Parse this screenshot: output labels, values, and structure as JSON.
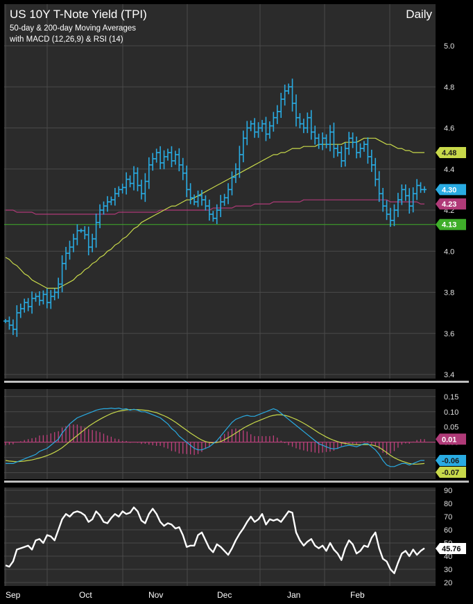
{
  "colors": {
    "background": "#2b2b2b",
    "grid": "#4a4a4a",
    "price": "#29abe2",
    "ma50": "#c8d94a",
    "ma200": "#b03a78",
    "support": "#3fae2a",
    "rsi": "#ffffff",
    "macd": "#29abe2",
    "signal": "#c8d94a",
    "histogram": "#c2407e"
  },
  "chart_data": [
    {
      "type": "line",
      "panel": "price",
      "title": "US 10Y T-Note Yield (TPI)",
      "subtitle_lines": [
        "50-day & 200-day Moving Averages",
        "with MACD (12,26,9) & RSI (14)"
      ],
      "period_label": "Daily",
      "ylim": [
        3.4,
        5.0
      ],
      "y_ticks": [
        "3.4",
        "3.6",
        "3.8",
        "4.0",
        "4.2",
        "4.4",
        "4.6",
        "4.8",
        "5.0"
      ],
      "x_months": [
        "Sep",
        "Oct",
        "Nov",
        "Dec",
        "Jan",
        "Feb"
      ],
      "series": [
        {
          "key": "price",
          "values": [
            3.66,
            3.64,
            3.62,
            3.7,
            3.72,
            3.75,
            3.73,
            3.77,
            3.78,
            3.76,
            3.79,
            3.75,
            3.78,
            3.8,
            3.84,
            3.94,
            3.99,
            4.02,
            4.06,
            4.1,
            4.1,
            4.08,
            4.02,
            4.06,
            4.14,
            4.2,
            4.22,
            4.24,
            4.25,
            4.28,
            4.3,
            4.31,
            4.35,
            4.33,
            4.38,
            4.32,
            4.28,
            4.34,
            4.42,
            4.45,
            4.48,
            4.43,
            4.46,
            4.48,
            4.44,
            4.47,
            4.42,
            4.38,
            4.3,
            4.26,
            4.24,
            4.27,
            4.25,
            4.22,
            4.18,
            4.16,
            4.2,
            4.24,
            4.26,
            4.3,
            4.36,
            4.4,
            4.47,
            4.55,
            4.6,
            4.62,
            4.58,
            4.6,
            4.62,
            4.57,
            4.61,
            4.65,
            4.68,
            4.74,
            4.78,
            4.8,
            4.72,
            4.65,
            4.62,
            4.6,
            4.65,
            4.58,
            4.55,
            4.52,
            4.55,
            4.52,
            4.58,
            4.5,
            4.48,
            4.44,
            4.5,
            4.55,
            4.53,
            4.48,
            4.5,
            4.52,
            4.46,
            4.42,
            4.35,
            4.28,
            4.22,
            4.18,
            4.15,
            4.2,
            4.25,
            4.3,
            4.27,
            4.22,
            4.28,
            4.32,
            4.3,
            4.3
          ]
        },
        {
          "key": "ma50",
          "values": [
            3.97,
            3.96,
            3.94,
            3.93,
            3.91,
            3.89,
            3.88,
            3.86,
            3.85,
            3.84,
            3.83,
            3.82,
            3.82,
            3.82,
            3.82,
            3.83,
            3.84,
            3.85,
            3.86,
            3.88,
            3.89,
            3.91,
            3.92,
            3.94,
            3.95,
            3.97,
            3.98,
            4.0,
            4.01,
            4.03,
            4.04,
            4.06,
            4.07,
            4.09,
            4.11,
            4.12,
            4.14,
            4.15,
            4.16,
            4.17,
            4.18,
            4.19,
            4.2,
            4.21,
            4.22,
            4.22,
            4.23,
            4.24,
            4.25,
            4.25,
            4.26,
            4.27,
            4.28,
            4.29,
            4.3,
            4.31,
            4.32,
            4.33,
            4.34,
            4.35,
            4.36,
            4.37,
            4.38,
            4.39,
            4.4,
            4.41,
            4.42,
            4.43,
            4.44,
            4.45,
            4.46,
            4.47,
            4.47,
            4.48,
            4.48,
            4.49,
            4.5,
            4.5,
            4.5,
            4.51,
            4.51,
            4.51,
            4.51,
            4.52,
            4.52,
            4.52,
            4.52,
            4.52,
            4.52,
            4.52,
            4.53,
            4.53,
            4.53,
            4.53,
            4.54,
            4.55,
            4.55,
            4.55,
            4.55,
            4.54,
            4.53,
            4.52,
            4.52,
            4.51,
            4.5,
            4.5,
            4.49,
            4.49,
            4.48,
            4.48,
            4.48,
            4.48
          ]
        },
        {
          "key": "ma200",
          "values": [
            4.2,
            4.2,
            4.2,
            4.19,
            4.19,
            4.19,
            4.19,
            4.19,
            4.18,
            4.18,
            4.18,
            4.18,
            4.18,
            4.18,
            4.18,
            4.18,
            4.18,
            4.18,
            4.18,
            4.18,
            4.18,
            4.18,
            4.18,
            4.18,
            4.18,
            4.18,
            4.18,
            4.18,
            4.18,
            4.18,
            4.19,
            4.19,
            4.19,
            4.19,
            4.19,
            4.19,
            4.19,
            4.19,
            4.19,
            4.19,
            4.19,
            4.2,
            4.2,
            4.2,
            4.2,
            4.2,
            4.2,
            4.2,
            4.2,
            4.2,
            4.2,
            4.2,
            4.2,
            4.2,
            4.2,
            4.21,
            4.21,
            4.21,
            4.21,
            4.21,
            4.21,
            4.22,
            4.22,
            4.22,
            4.22,
            4.22,
            4.23,
            4.23,
            4.23,
            4.23,
            4.23,
            4.24,
            4.24,
            4.24,
            4.24,
            4.24,
            4.24,
            4.24,
            4.24,
            4.25,
            4.25,
            4.25,
            4.25,
            4.25,
            4.25,
            4.25,
            4.25,
            4.25,
            4.25,
            4.25,
            4.25,
            4.25,
            4.25,
            4.25,
            4.25,
            4.25,
            4.25,
            4.25,
            4.25,
            4.25,
            4.25,
            4.25,
            4.24,
            4.24,
            4.24,
            4.24,
            4.24,
            4.24,
            4.24,
            4.24,
            4.23,
            4.23
          ]
        }
      ],
      "horizontal_line": 4.13,
      "tags": [
        {
          "label": "4.48",
          "value": 4.48,
          "color": "#c8d94a",
          "text_color": "#1a1a1a"
        },
        {
          "label": "4.30",
          "value": 4.3,
          "color": "#29abe2",
          "text_color": "#ffffff"
        },
        {
          "label": "4.23",
          "value": 4.23,
          "color": "#b03a78",
          "text_color": "#ffffff"
        },
        {
          "label": "4.13",
          "value": 4.13,
          "color": "#3fae2a",
          "text_color": "#ffffff"
        }
      ]
    },
    {
      "type": "line",
      "panel": "macd",
      "ylim": [
        -0.11,
        0.17
      ],
      "y_ticks": [
        "-0.10",
        "-0.05",
        "0.00",
        "0.05",
        "0.10",
        "0.15"
      ],
      "series": [
        {
          "key": "macd",
          "values": [
            -0.07,
            -0.07,
            -0.07,
            -0.065,
            -0.06,
            -0.055,
            -0.05,
            -0.045,
            -0.04,
            -0.03,
            -0.025,
            -0.02,
            -0.01,
            0.0,
            0.01,
            0.03,
            0.045,
            0.06,
            0.07,
            0.08,
            0.085,
            0.09,
            0.095,
            0.1,
            0.105,
            0.108,
            0.11,
            0.11,
            0.112,
            0.11,
            0.112,
            0.108,
            0.11,
            0.105,
            0.108,
            0.105,
            0.1,
            0.1,
            0.095,
            0.09,
            0.085,
            0.08,
            0.07,
            0.06,
            0.045,
            0.035,
            0.02,
            0.01,
            0.0,
            -0.01,
            -0.02,
            -0.025,
            -0.025,
            -0.02,
            -0.015,
            -0.005,
            0.005,
            0.02,
            0.035,
            0.05,
            0.065,
            0.075,
            0.08,
            0.085,
            0.088,
            0.085,
            0.085,
            0.09,
            0.095,
            0.1,
            0.105,
            0.11,
            0.105,
            0.095,
            0.085,
            0.075,
            0.065,
            0.055,
            0.045,
            0.035,
            0.025,
            0.015,
            0.005,
            -0.005,
            -0.01,
            -0.015,
            -0.02,
            -0.022,
            -0.02,
            -0.015,
            -0.012,
            -0.01,
            -0.012,
            -0.015,
            -0.01,
            -0.005,
            -0.005,
            -0.015,
            -0.025,
            -0.04,
            -0.06,
            -0.075,
            -0.08,
            -0.08,
            -0.075,
            -0.07,
            -0.07,
            -0.075,
            -0.07,
            -0.065,
            -0.06,
            -0.06
          ]
        },
        {
          "key": "signal",
          "values": [
            -0.06,
            -0.062,
            -0.063,
            -0.064,
            -0.063,
            -0.062,
            -0.06,
            -0.058,
            -0.055,
            -0.052,
            -0.048,
            -0.044,
            -0.039,
            -0.033,
            -0.026,
            -0.018,
            -0.008,
            0.002,
            0.012,
            0.022,
            0.032,
            0.042,
            0.052,
            0.06,
            0.068,
            0.075,
            0.082,
            0.088,
            0.094,
            0.098,
            0.102,
            0.104,
            0.106,
            0.107,
            0.107,
            0.107,
            0.106,
            0.105,
            0.103,
            0.1,
            0.097,
            0.092,
            0.087,
            0.081,
            0.074,
            0.066,
            0.057,
            0.048,
            0.039,
            0.03,
            0.022,
            0.014,
            0.007,
            0.002,
            -0.001,
            -0.002,
            -0.001,
            0.002,
            0.008,
            0.015,
            0.022,
            0.03,
            0.038,
            0.046,
            0.053,
            0.059,
            0.065,
            0.07,
            0.075,
            0.08,
            0.085,
            0.088,
            0.09,
            0.09,
            0.088,
            0.085,
            0.08,
            0.075,
            0.069,
            0.062,
            0.055,
            0.047,
            0.039,
            0.031,
            0.024,
            0.017,
            0.011,
            0.006,
            0.002,
            -0.002,
            -0.004,
            -0.006,
            -0.007,
            -0.008,
            -0.008,
            -0.008,
            -0.008,
            -0.009,
            -0.012,
            -0.017,
            -0.025,
            -0.034,
            -0.043,
            -0.051,
            -0.057,
            -0.062,
            -0.066,
            -0.07,
            -0.072,
            -0.072,
            -0.071,
            -0.07
          ]
        },
        {
          "key": "histogram",
          "values": [
            -0.01,
            -0.008,
            -0.007,
            -0.001,
            0.003,
            0.007,
            0.01,
            0.013,
            0.015,
            0.022,
            0.023,
            0.024,
            0.029,
            0.033,
            0.036,
            0.048,
            0.053,
            0.058,
            0.058,
            0.058,
            0.053,
            0.048,
            0.043,
            0.04,
            0.037,
            0.033,
            0.028,
            0.022,
            0.018,
            0.012,
            0.01,
            0.004,
            0.004,
            -0.002,
            0.001,
            -0.002,
            -0.006,
            -0.005,
            -0.008,
            -0.01,
            -0.012,
            -0.012,
            -0.017,
            -0.021,
            -0.029,
            -0.031,
            -0.037,
            -0.038,
            -0.039,
            -0.04,
            -0.042,
            -0.039,
            -0.032,
            -0.022,
            -0.014,
            -0.003,
            0.006,
            0.018,
            0.027,
            0.035,
            0.043,
            0.045,
            0.042,
            0.039,
            0.035,
            0.026,
            0.02,
            0.02,
            0.02,
            0.02,
            0.02,
            0.022,
            0.015,
            0.005,
            -0.003,
            -0.01,
            -0.015,
            -0.02,
            -0.024,
            -0.027,
            -0.03,
            -0.032,
            -0.034,
            -0.036,
            -0.034,
            -0.032,
            -0.031,
            -0.028,
            -0.022,
            -0.013,
            -0.008,
            -0.004,
            -0.005,
            -0.007,
            -0.002,
            0.003,
            0.003,
            -0.006,
            -0.013,
            -0.023,
            -0.035,
            -0.041,
            -0.037,
            -0.029,
            -0.018,
            -0.008,
            -0.004,
            -0.005,
            0.002,
            0.007,
            0.01,
            0.01
          ]
        }
      ],
      "tags": [
        {
          "label": "0.01",
          "value": 0.01,
          "color": "#b03a78",
          "text_color": "#ffffff"
        },
        {
          "label": "-0.06",
          "value": -0.06,
          "color": "#29abe2",
          "text_color": "#1a1a1a"
        },
        {
          "label": "-0.07",
          "value": -0.07,
          "color": "#c8d94a",
          "text_color": "#1a1a1a"
        }
      ]
    },
    {
      "type": "line",
      "panel": "rsi",
      "ylim": [
        20,
        90
      ],
      "y_ticks": [
        "20",
        "30",
        "40",
        "50",
        "60",
        "70",
        "80",
        "90"
      ],
      "series": [
        {
          "key": "rsi",
          "values": [
            33,
            32,
            36,
            45,
            46,
            47,
            48,
            45,
            52,
            53,
            50,
            56,
            55,
            52,
            60,
            68,
            72,
            70,
            73,
            74,
            73,
            71,
            66,
            68,
            74,
            71,
            66,
            65,
            69,
            72,
            70,
            74,
            72,
            73,
            77,
            74,
            67,
            65,
            72,
            76,
            72,
            66,
            63,
            65,
            64,
            61,
            62,
            56,
            47,
            48,
            48,
            56,
            58,
            52,
            46,
            43,
            49,
            47,
            44,
            41,
            46,
            52,
            57,
            61,
            66,
            70,
            66,
            68,
            72,
            64,
            68,
            67,
            68,
            66,
            70,
            74,
            73,
            58,
            52,
            48,
            51,
            53,
            48,
            46,
            48,
            44,
            50,
            45,
            42,
            37,
            46,
            52,
            49,
            42,
            44,
            48,
            47,
            54,
            58,
            46,
            38,
            36,
            30,
            27,
            35,
            42,
            44,
            40,
            45,
            41,
            44,
            46
          ]
        }
      ],
      "tags": [
        {
          "label": "45.76",
          "value": 45.76,
          "color": "#ffffff",
          "text_color": "#000000"
        }
      ]
    }
  ]
}
